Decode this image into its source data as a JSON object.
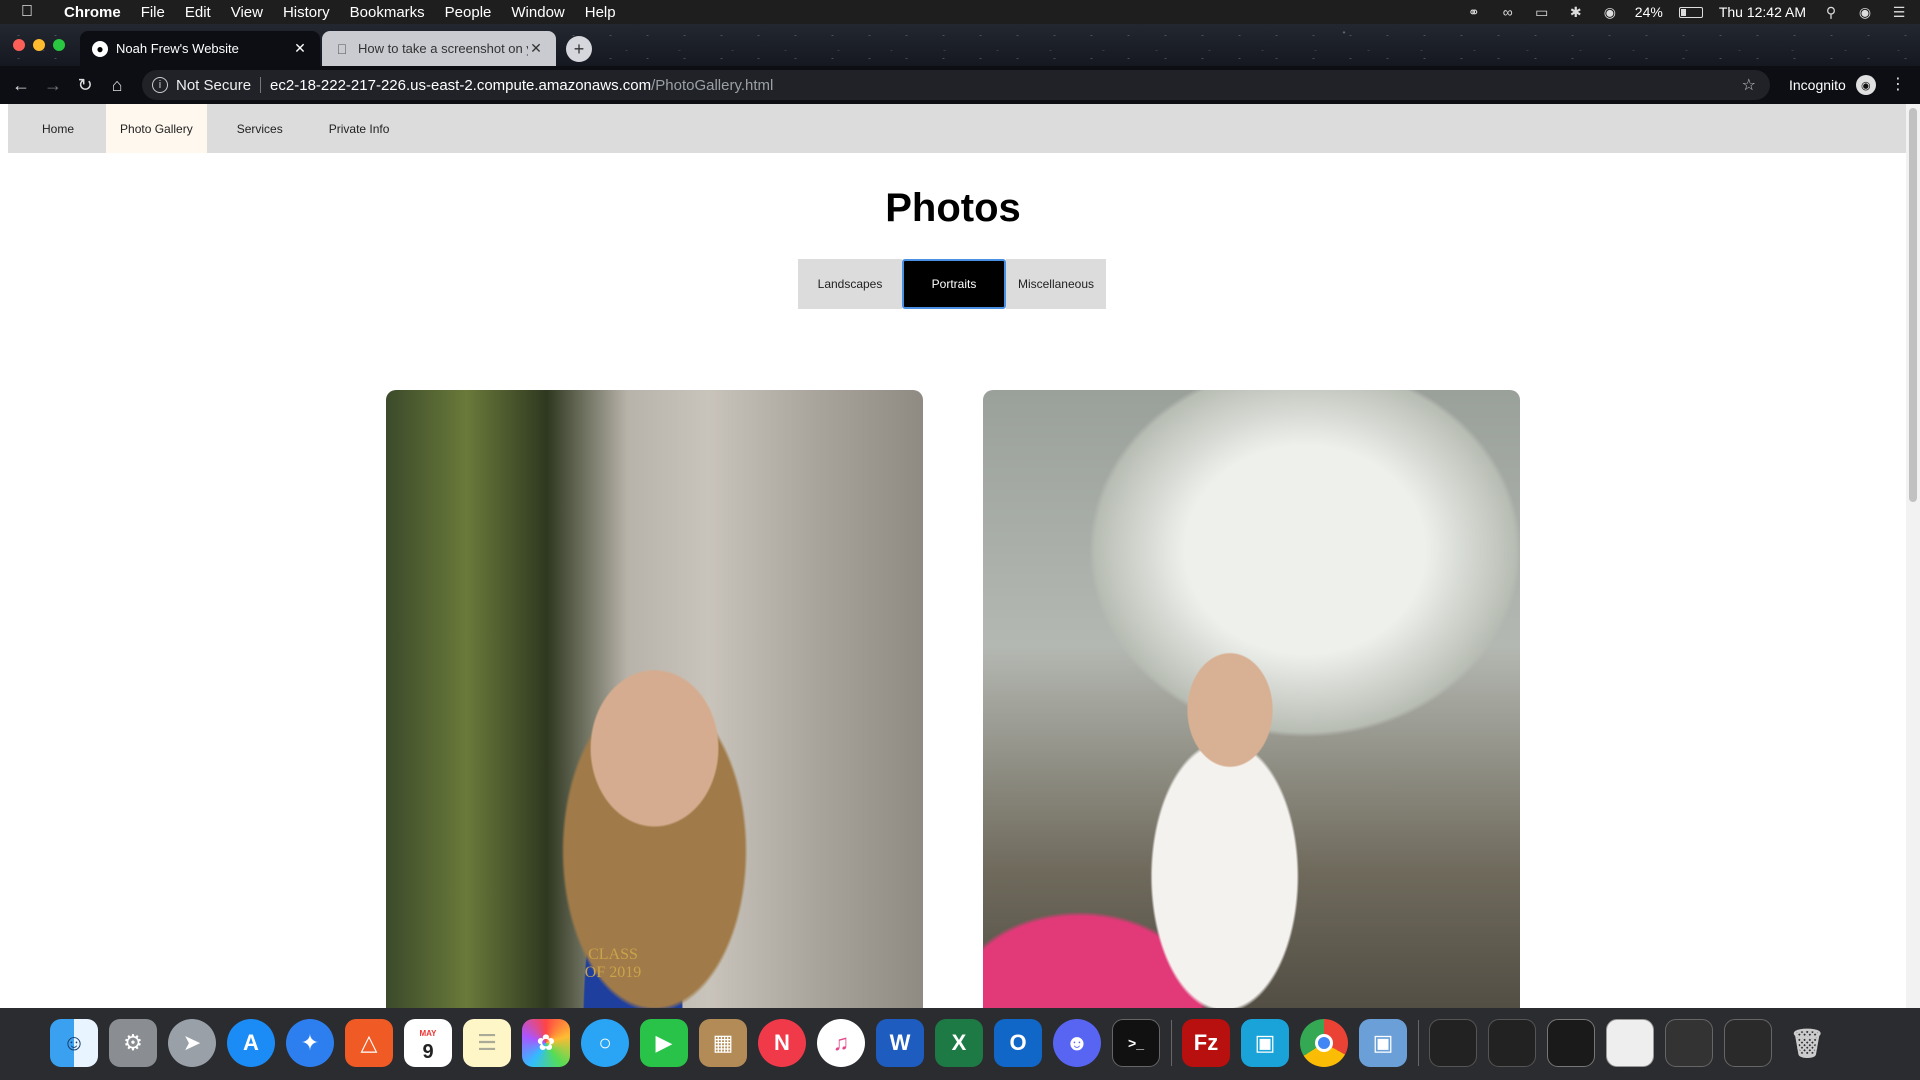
{
  "menubar": {
    "app": "Chrome",
    "items": [
      "File",
      "Edit",
      "View",
      "History",
      "Bookmarks",
      "People",
      "Window",
      "Help"
    ],
    "battery": "24%",
    "battery_level": 0.24,
    "clock": "Thu 12:42 AM"
  },
  "tabs": [
    {
      "title": "Noah Frew's Website",
      "favicon": "globe-icon"
    },
    {
      "title": "How to take a screenshot on your Mac - Apple Support",
      "favicon": "apple-icon"
    }
  ],
  "toolbar": {
    "security": "Not Secure",
    "url_host": "ec2-18-222-217-226.us-east-2.compute.amazonaws.com",
    "url_path": "/PhotoGallery.html",
    "profile": "Incognito"
  },
  "site": {
    "nav": [
      "Home",
      "Photo Gallery",
      "Services",
      "Private Info"
    ],
    "current_nav": "Photo Gallery",
    "title": "Photos",
    "filters": [
      "Landscapes",
      "Portraits",
      "Miscellaneous"
    ],
    "active_filter": "Portraits",
    "photo_caption_text": "CLASS OF 2019"
  },
  "dock": {
    "apps": [
      "Finder",
      "System Preferences",
      "Launchpad",
      "App Store",
      "Safari",
      "Brave",
      "Calendar",
      "Notes",
      "Photos",
      "Messages",
      "FaceTime",
      "Notefile",
      "News",
      "iTunes",
      "Word",
      "Excel",
      "Outlook",
      "Discord",
      "Terminal",
      "FileZilla",
      "Frame",
      "Chrome",
      "Preview"
    ],
    "calendar_month": "MAY",
    "calendar_day": "9"
  },
  "colors": {
    "nav_bg": "#dcdcdc",
    "nav_current_bg": "#fff8ee",
    "filter_active_bg": "#000000",
    "filter_active_border": "#4a90e2"
  }
}
